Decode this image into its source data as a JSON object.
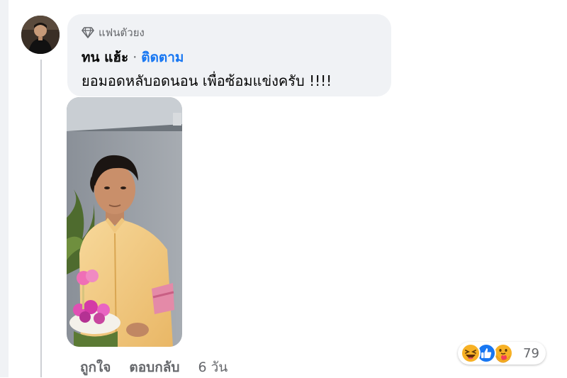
{
  "comment": {
    "badge_label": "แฟนตัวยง",
    "author_name": "ทน แฮ้ะ",
    "separator": "·",
    "follow_label": "ติดตาม",
    "text": "ยอมอดหลับอดนอน เพื่อซ้อมแข่งครับ !!!!"
  },
  "actions": {
    "like_label": "ถูกใจ",
    "reply_label": "ตอบกลับ",
    "time": "6 วัน"
  },
  "reactions": {
    "types": [
      "haha",
      "like",
      "care"
    ],
    "count": "79"
  },
  "colors": {
    "link_blue": "#1877f2",
    "bubble_bg": "#f0f2f5",
    "secondary_text": "#65676b",
    "reaction_yellow": "#f7b125"
  },
  "icons": {
    "badge": "diamond-icon",
    "reaction_haha": "haha-reaction-icon",
    "reaction_like": "like-reaction-icon",
    "reaction_care": "care-reaction-icon"
  }
}
